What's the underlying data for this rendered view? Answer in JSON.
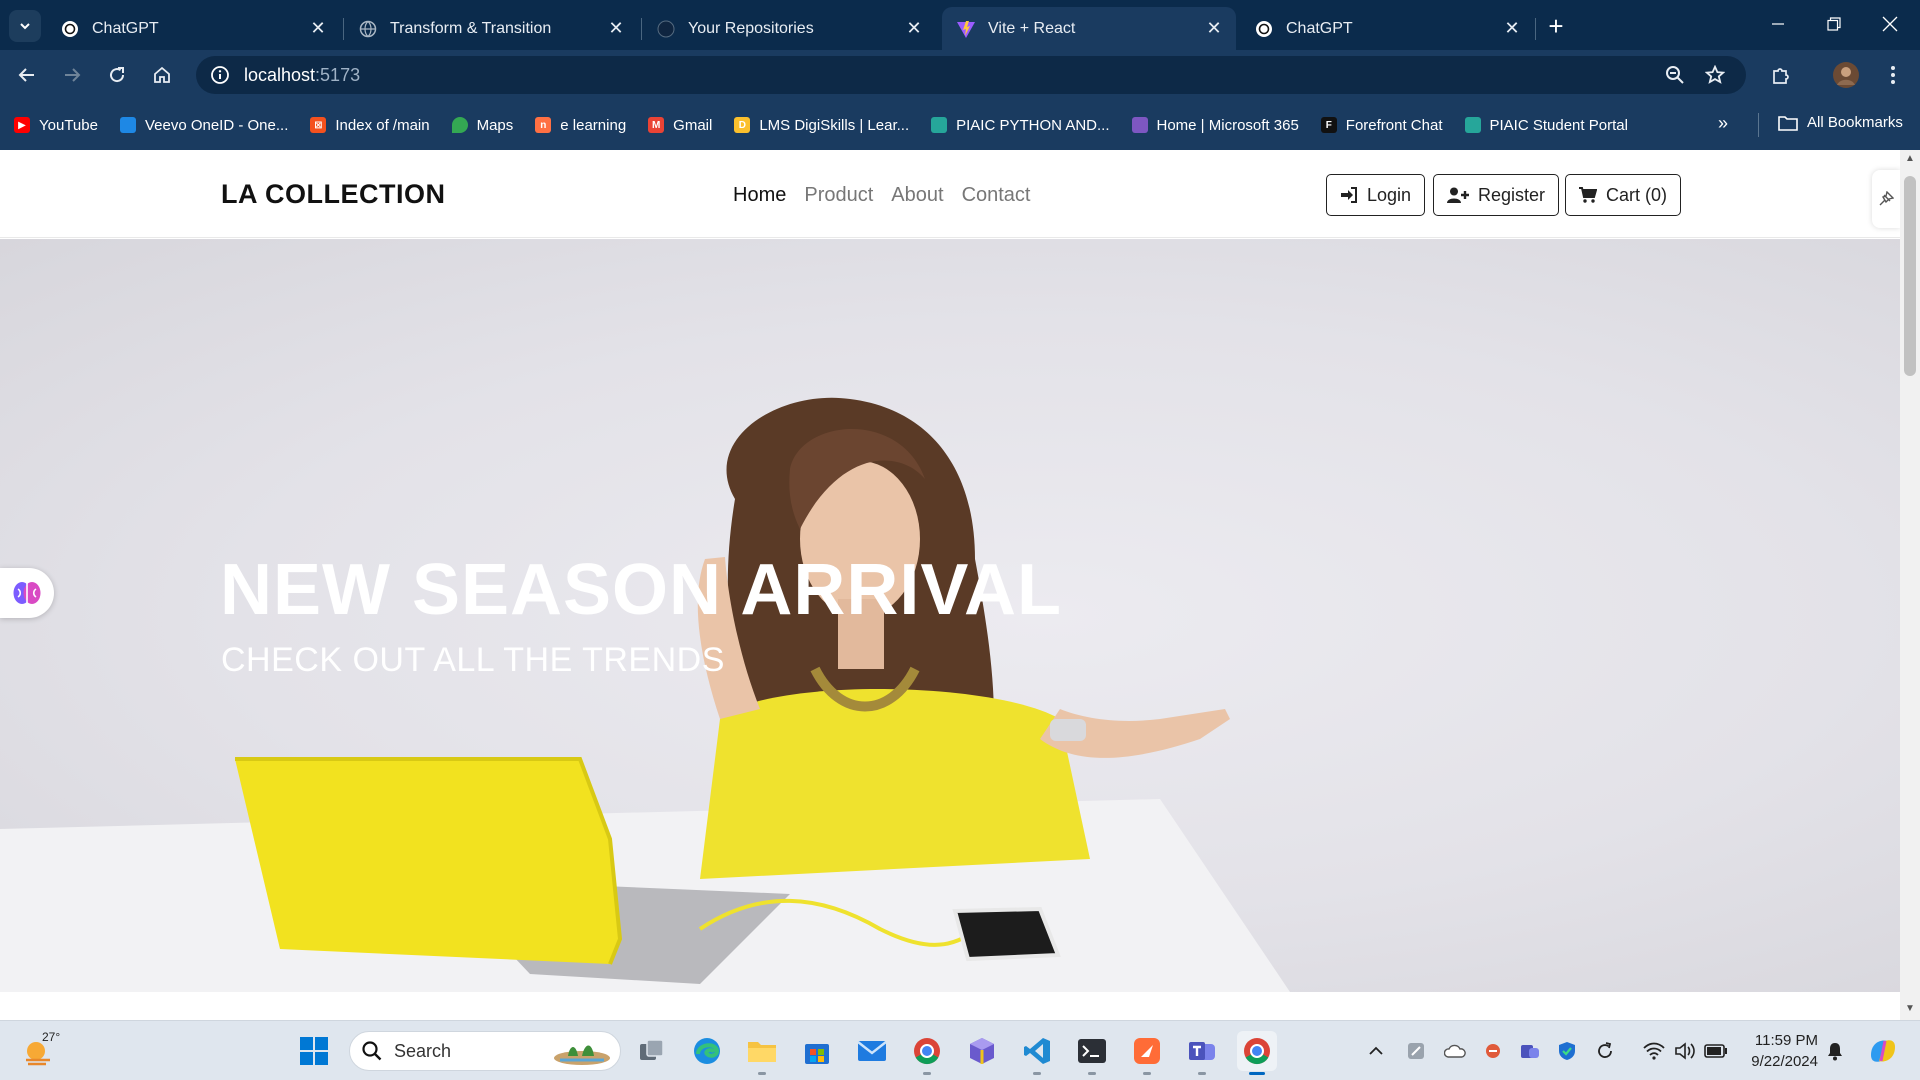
{
  "browser": {
    "tabs": [
      {
        "title": "ChatGPT",
        "active": false
      },
      {
        "title": "Transform & Transition",
        "active": false
      },
      {
        "title": "Your Repositories",
        "active": false
      },
      {
        "title": "Vite + React",
        "active": true
      },
      {
        "title": "ChatGPT",
        "active": false
      }
    ],
    "url": {
      "host": "localhost",
      "port": ":5173"
    },
    "bookmarks": [
      {
        "label": "YouTube",
        "color": "#ff0000"
      },
      {
        "label": "Veevo OneID - One...",
        "color": "#1e88e5"
      },
      {
        "label": "Index of /main",
        "color": "#f4511e"
      },
      {
        "label": "Maps",
        "color": "#34a853"
      },
      {
        "label": "e learning",
        "color": "#ff7043"
      },
      {
        "label": "Gmail",
        "color": "#ea4335"
      },
      {
        "label": "LMS DigiSkills | Lear...",
        "color": "#fbc02d"
      },
      {
        "label": "PIAIC PYTHON AND...",
        "color": "#26a69a"
      },
      {
        "label": "Home | Microsoft 365",
        "color": "#7e57c2"
      },
      {
        "label": "Forefront Chat",
        "color": "#111111"
      },
      {
        "label": "PIAIC Student Portal",
        "color": "#26a69a"
      }
    ],
    "all_bookmarks_label": "All Bookmarks"
  },
  "site": {
    "brand": "LA COLLECTION",
    "nav": [
      {
        "label": "Home",
        "active": true
      },
      {
        "label": "Product",
        "active": false
      },
      {
        "label": "About",
        "active": false
      },
      {
        "label": "Contact",
        "active": false
      }
    ],
    "login_label": "Login",
    "register_label": "Register",
    "cart_label": "Cart (0)",
    "hero": {
      "title": "NEW SEASON ARRIVAL",
      "subtitle": "CHECK OUT ALL THE TRENDS"
    }
  },
  "taskbar": {
    "temperature": "27°",
    "search_placeholder": "Search",
    "time": "11:59 PM",
    "date": "9/22/2024"
  }
}
